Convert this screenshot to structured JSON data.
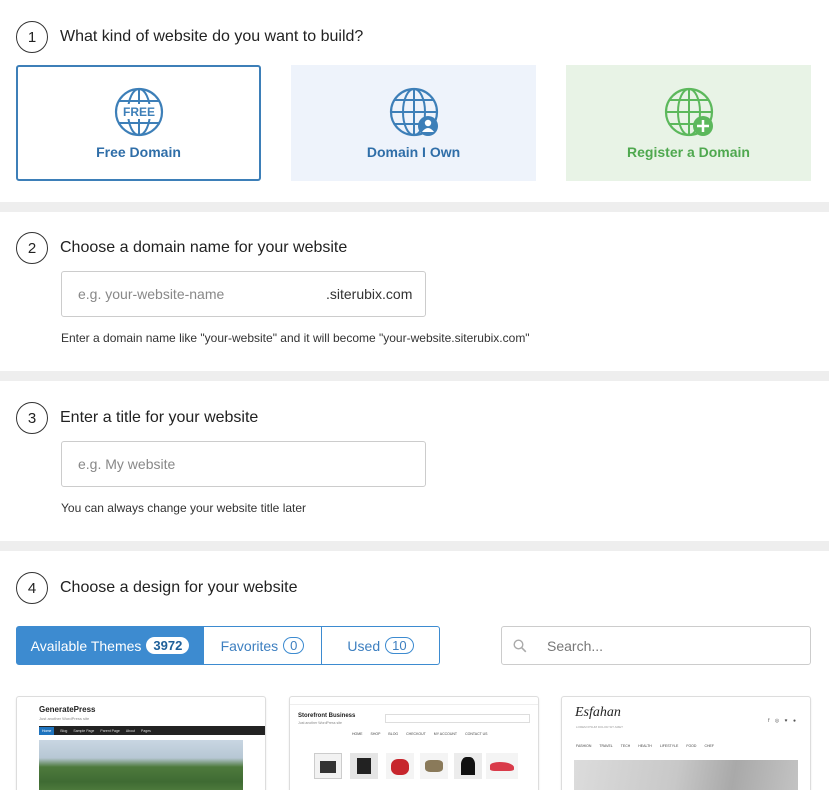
{
  "steps": [
    {
      "num": "1",
      "title": "What kind of website do you want to build?"
    },
    {
      "num": "2",
      "title": "Choose a domain name for your website"
    },
    {
      "num": "3",
      "title": "Enter a title for your website"
    },
    {
      "num": "4",
      "title": "Choose a design for your website"
    }
  ],
  "domain_options": [
    {
      "label": "Free Domain",
      "icon": "globe-free-icon",
      "badge": "FREE",
      "selected": true
    },
    {
      "label": "Domain I Own",
      "icon": "globe-user-icon",
      "selected": false
    },
    {
      "label": "Register a Domain",
      "icon": "globe-plus-icon",
      "selected": false
    }
  ],
  "domain": {
    "placeholder": "e.g. your-website-name",
    "suffix": ".siterubix.com",
    "hint": "Enter a domain name like \"your-website\" and it will become \"your-website.siterubix.com\""
  },
  "site_title": {
    "placeholder": "e.g. My website",
    "hint": "You can always change your website title later"
  },
  "design": {
    "tabs": [
      {
        "label": "Available Themes",
        "count": "3972",
        "active": true
      },
      {
        "label": "Favorites",
        "count": "0",
        "active": false
      },
      {
        "label": "Used",
        "count": "10",
        "active": false
      }
    ],
    "search_placeholder": "Search..."
  },
  "themes": [
    {
      "name": "GeneratePress",
      "tagline": "Just another WordPress site",
      "nav": [
        "Home",
        "Blog",
        "Sample Page",
        "Parent Page",
        "About",
        "Pages"
      ]
    },
    {
      "name": "Storefront Business",
      "tagline": "Just another WordPress site",
      "nav": [
        "HOME",
        "SHOP",
        "BLOG",
        "CHECKOUT",
        "MY ACCOUNT",
        "CONTACT US"
      ]
    },
    {
      "name": "Esfahan",
      "tagline": "LOREM IPSUM DOLOR SIT AMET",
      "nav": [
        "FASHION",
        "TRAVEL",
        "TECH",
        "HEALTH",
        "LIFESTYLE",
        "FOOD",
        "CHEF"
      ]
    }
  ],
  "colors": {
    "accent": "#3d8bd0",
    "free_card_bg": "#ffffff",
    "own_card_bg": "#eef3fb",
    "register_card_bg": "#e8f3e6",
    "register_green": "#5cb85c"
  }
}
